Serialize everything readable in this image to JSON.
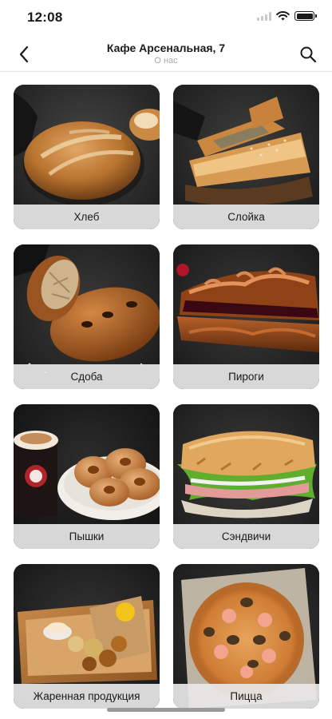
{
  "status_bar": {
    "time": "12:08"
  },
  "header": {
    "title": "Кафе Арсенальная, 7",
    "subtitle": "О нас"
  },
  "categories": [
    {
      "label": "Хлеб"
    },
    {
      "label": "Слойка"
    },
    {
      "label": "Сдоба"
    },
    {
      "label": "Пироги"
    },
    {
      "label": "Пышки"
    },
    {
      "label": "Сэндвичи"
    },
    {
      "label": "Жаренная продукция"
    },
    {
      "label": "Пицца"
    }
  ],
  "colors": {
    "card_background": "#2b2b2b",
    "label_bar": "#e8e8e8",
    "text": "#1a1a1a",
    "subtitle": "#a8a8a8"
  }
}
